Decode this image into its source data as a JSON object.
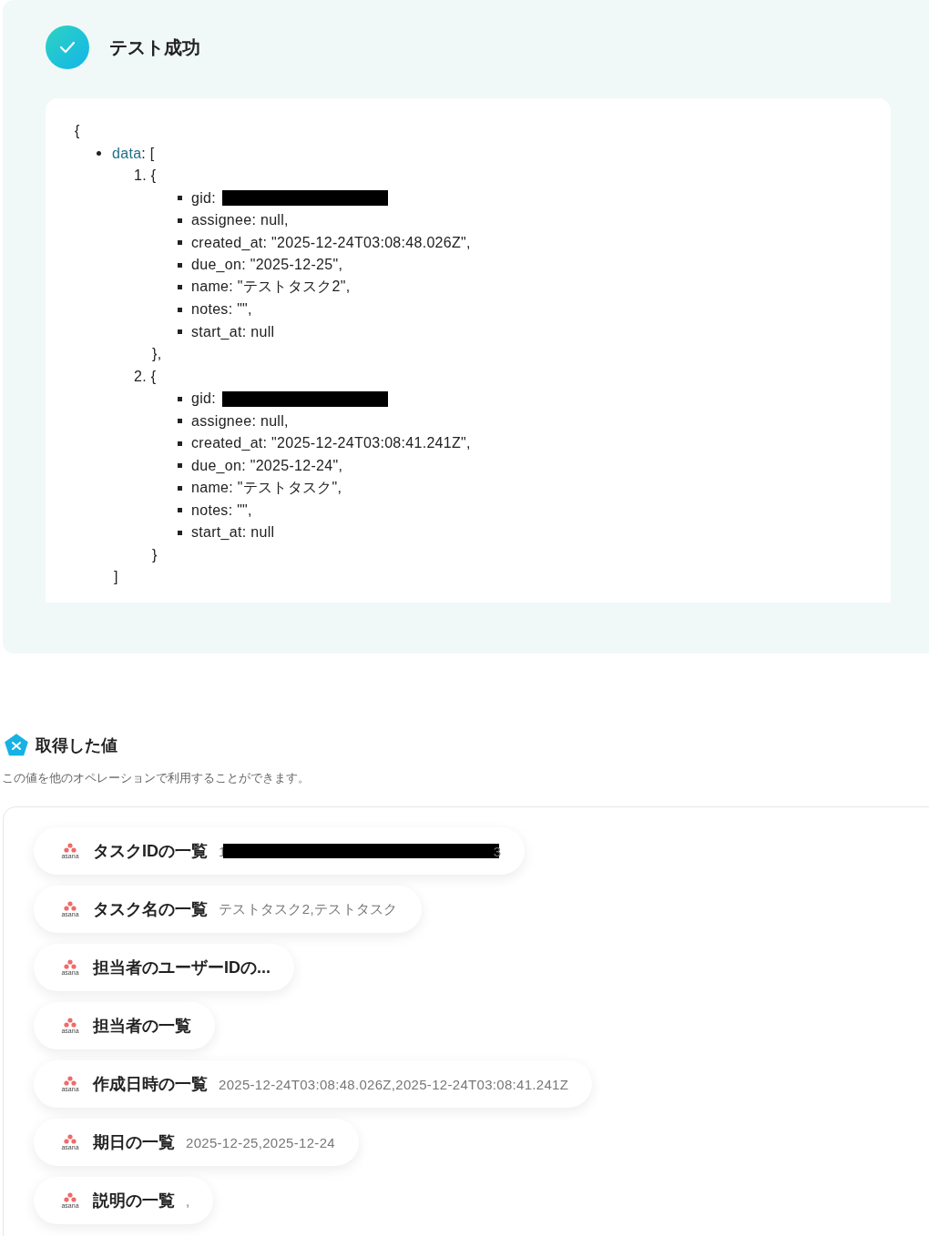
{
  "test_result": {
    "title": "テスト成功",
    "json_view": {
      "open": "{",
      "key": "data",
      "key_suffix": ": [",
      "close": "]",
      "items": [
        {
          "number": "1.",
          "open": "{",
          "close": "},",
          "fields": [
            {
              "kind": "redacted",
              "text": "gid:"
            },
            {
              "kind": "text",
              "text": "assignee: null,"
            },
            {
              "kind": "text",
              "text": "created_at: \"2025-12-24T03:08:48.026Z\","
            },
            {
              "kind": "text",
              "text": "due_on: \"2025-12-25\","
            },
            {
              "kind": "text",
              "text": "name: \"テストタスク2\","
            },
            {
              "kind": "text",
              "text": "notes: \"\","
            },
            {
              "kind": "text",
              "text": "start_at: null"
            }
          ]
        },
        {
          "number": "2.",
          "open": "{",
          "close": "}",
          "fields": [
            {
              "kind": "redacted",
              "text": "gid:"
            },
            {
              "kind": "text",
              "text": "assignee: null,"
            },
            {
              "kind": "text",
              "text": "created_at: \"2025-12-24T03:08:41.241Z\","
            },
            {
              "kind": "text",
              "text": "due_on: \"2025-12-24\","
            },
            {
              "kind": "text",
              "text": "name: \"テストタスク\","
            },
            {
              "kind": "text",
              "text": "notes: \"\","
            },
            {
              "kind": "text",
              "text": "start_at: null"
            }
          ]
        }
      ]
    }
  },
  "values_section": {
    "title": "取得した値",
    "description": "この値を他のオペレーションで利用することができます。",
    "chips": [
      {
        "logo": "asana",
        "label": "タスクIDの一覧",
        "value_parts": [
          {
            "kind": "text",
            "text": "1"
          },
          {
            "kind": "redacted"
          },
          {
            "kind": "text",
            "text": "3"
          }
        ]
      },
      {
        "logo": "asana",
        "label": "タスク名の一覧",
        "value_parts": [
          {
            "kind": "text",
            "text": "テストタスク2,テストタスク"
          }
        ]
      },
      {
        "logo": "asana",
        "label": "担当者のユーザーIDの..."
      },
      {
        "logo": "asana",
        "label": "担当者の一覧"
      },
      {
        "logo": "asana",
        "label": "作成日時の一覧",
        "value_parts": [
          {
            "kind": "text",
            "text": "2025-12-24T03:08:48.026Z,2025-12-24T03:08:41.241Z"
          }
        ]
      },
      {
        "logo": "asana",
        "label": "期日の一覧",
        "value_parts": [
          {
            "kind": "text",
            "text": "2025-12-25,2025-12-24"
          }
        ]
      },
      {
        "logo": "asana",
        "label": "説明の一覧",
        "value_parts": [
          {
            "kind": "text",
            "text": ","
          }
        ]
      }
    ]
  }
}
